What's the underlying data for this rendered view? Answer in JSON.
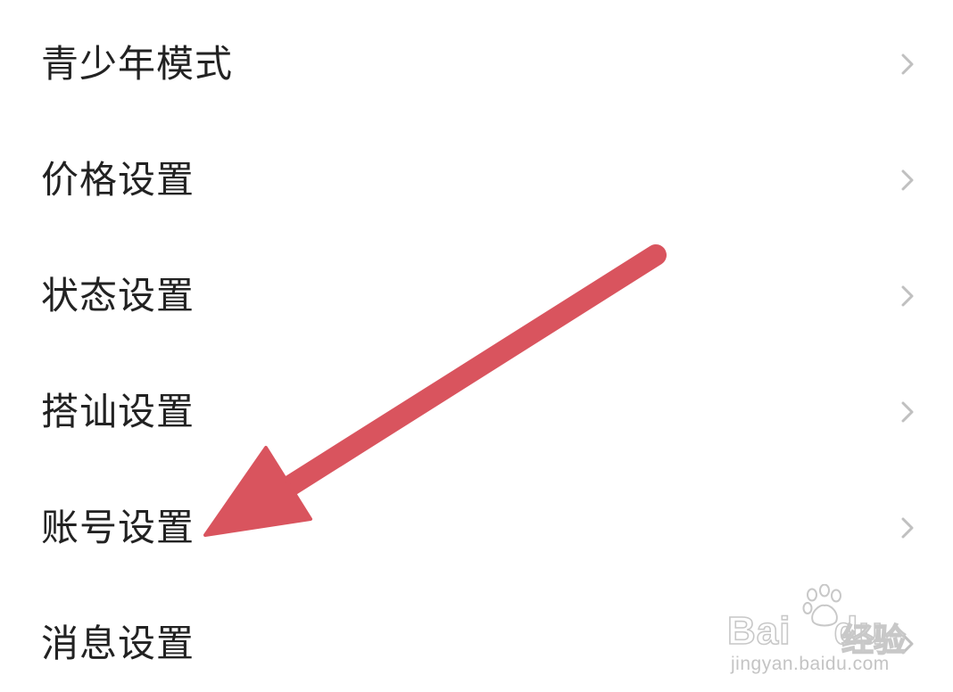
{
  "menu": {
    "items": [
      {
        "label": "青少年模式",
        "icon": "chevron-right-icon"
      },
      {
        "label": "价格设置",
        "icon": "chevron-right-icon"
      },
      {
        "label": "状态设置",
        "icon": "chevron-right-icon"
      },
      {
        "label": "搭讪设置",
        "icon": "chevron-right-icon"
      },
      {
        "label": "账号设置",
        "icon": "chevron-right-icon"
      },
      {
        "label": "消息设置",
        "icon": "chevron-right-icon"
      }
    ]
  },
  "annotation": {
    "icon": "arrow-pointer-icon",
    "color": "#d9545e",
    "points_to": "账号设置"
  },
  "watermark": {
    "brand": "Bai",
    "brand_suffix": "du",
    "product": "经验",
    "url": "jingyan.baidu.com",
    "icon": "paw-logo-icon"
  },
  "colors": {
    "text": "#222222",
    "chevron": "#c0c0c0",
    "background": "#ffffff"
  }
}
